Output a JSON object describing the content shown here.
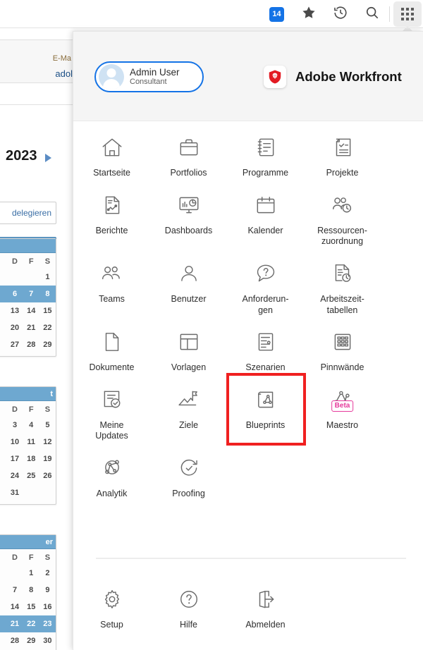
{
  "browser_toolbar": {
    "badge_count": "14",
    "icons": [
      {
        "name": "extension-badge",
        "label": "14"
      },
      {
        "name": "bookmark-star-icon",
        "glyph": "star"
      },
      {
        "name": "history-clock-icon",
        "glyph": "history"
      },
      {
        "name": "search-icon",
        "glyph": "magnifier"
      },
      {
        "name": "apps-grid-icon",
        "glyph": "grid"
      }
    ]
  },
  "background_page": {
    "email_label": "E-Ma",
    "email_value": "adol",
    "year": "2023",
    "delegate_button": "delegieren",
    "calendars": [
      {
        "title": "",
        "dow": [
          "D",
          "F",
          "S"
        ],
        "weeks": [
          {
            "days": [
              "",
              "",
              "1"
            ],
            "selected": false
          },
          {
            "days": [
              "6",
              "7",
              "8"
            ],
            "selected": true
          },
          {
            "days": [
              "13",
              "14",
              "15"
            ],
            "selected": false
          },
          {
            "days": [
              "20",
              "21",
              "22"
            ],
            "selected": false
          },
          {
            "days": [
              "27",
              "28",
              "29"
            ],
            "selected": false
          }
        ]
      },
      {
        "title": "t",
        "dow": [
          "D",
          "F",
          "S"
        ],
        "weeks": [
          {
            "days": [
              "3",
              "4",
              "5"
            ],
            "selected": false
          },
          {
            "days": [
              "10",
              "11",
              "12"
            ],
            "selected": false
          },
          {
            "days": [
              "17",
              "18",
              "19"
            ],
            "selected": false
          },
          {
            "days": [
              "24",
              "25",
              "26"
            ],
            "selected": false
          },
          {
            "days": [
              "31",
              "",
              ""
            ],
            "selected": false
          }
        ]
      },
      {
        "title": "er",
        "dow": [
          "D",
          "F",
          "S"
        ],
        "weeks": [
          {
            "days": [
              "",
              "1",
              "2"
            ],
            "selected": false
          },
          {
            "days": [
              "7",
              "8",
              "9"
            ],
            "selected": false
          },
          {
            "days": [
              "14",
              "15",
              "16"
            ],
            "selected": false
          },
          {
            "days": [
              "21",
              "22",
              "23"
            ],
            "selected": true
          },
          {
            "days": [
              "28",
              "29",
              "30"
            ],
            "selected": false
          }
        ]
      }
    ]
  },
  "panel": {
    "header": {
      "user_name": "Admin User",
      "user_role": "Consultant",
      "brand_name": "Adobe Workfront",
      "avatar_name": "avatar",
      "logo_name": "adobe-workfront-logo"
    },
    "app_rows": [
      [
        {
          "label": "Startseite",
          "icon": "home-icon",
          "name": "app-item-startseite"
        },
        {
          "label": "Portfolios",
          "icon": "briefcase-icon",
          "name": "app-item-portfolios"
        },
        {
          "label": "Programme",
          "icon": "notebook-icon",
          "name": "app-item-programme"
        },
        {
          "label": "Projekte",
          "icon": "checklist-document-icon",
          "name": "app-item-projekte"
        }
      ],
      [
        {
          "label": "Berichte",
          "icon": "report-document-icon",
          "name": "app-item-berichte"
        },
        {
          "label": "Dashboards",
          "icon": "monitor-chart-icon",
          "name": "app-item-dashboards"
        },
        {
          "label": "Kalender",
          "icon": "calendar-icon",
          "name": "app-item-kalender"
        },
        {
          "label": "Ressourcen-\nzuordnung",
          "icon": "people-clock-icon",
          "name": "app-item-ressourcenzuordnung"
        }
      ],
      [
        {
          "label": "Teams",
          "icon": "people-icon",
          "name": "app-item-teams"
        },
        {
          "label": "Benutzer",
          "icon": "person-icon",
          "name": "app-item-benutzer"
        },
        {
          "label": "Anforderun-\ngen",
          "icon": "question-bubble-icon",
          "name": "app-item-anforderungen"
        },
        {
          "label": "Arbeitszeit-\ntabellen",
          "icon": "document-clock-icon",
          "name": "app-item-arbeitszeittabellen"
        }
      ],
      [
        {
          "label": "Dokumente",
          "icon": "page-icon",
          "name": "app-item-dokumente"
        },
        {
          "label": "Vorlagen",
          "icon": "layout-template-icon",
          "name": "app-item-vorlagen"
        },
        {
          "label": "Szenarien",
          "icon": "gantt-icon",
          "name": "app-item-szenarien"
        },
        {
          "label": "Pinnwände",
          "icon": "board-grid-icon",
          "name": "app-item-pinnwaende"
        }
      ],
      [
        {
          "label": "Meine\nUpdates",
          "icon": "document-check-icon",
          "name": "app-item-meine-updates"
        },
        {
          "label": "Ziele",
          "icon": "mountain-flag-icon",
          "name": "app-item-ziele"
        },
        {
          "label": "Blueprints",
          "icon": "blueprint-icon",
          "name": "app-item-blueprints",
          "highlighted": true
        },
        {
          "label": "Maestro",
          "icon": "nodes-graph-icon",
          "name": "app-item-maestro",
          "badge": "Beta"
        }
      ],
      [
        {
          "label": "Analytik",
          "icon": "analytics-icon",
          "name": "app-item-analytik"
        },
        {
          "label": "Proofing",
          "icon": "proof-check-icon",
          "name": "app-item-proofing"
        }
      ]
    ],
    "footer_rows": [
      [
        {
          "label": "Setup",
          "icon": "gear-icon",
          "name": "app-item-setup"
        },
        {
          "label": "Hilfe",
          "icon": "question-circle-icon",
          "name": "app-item-hilfe"
        },
        {
          "label": "Abmelden",
          "icon": "logout-icon",
          "name": "app-item-abmelden"
        }
      ]
    ]
  },
  "colors": {
    "accent_blue": "#1473e6",
    "highlight_red": "#f02020",
    "beta_pink": "#e6399b",
    "header_bg": "#f5f5f5",
    "calendar_blue": "#6ea8d0"
  }
}
